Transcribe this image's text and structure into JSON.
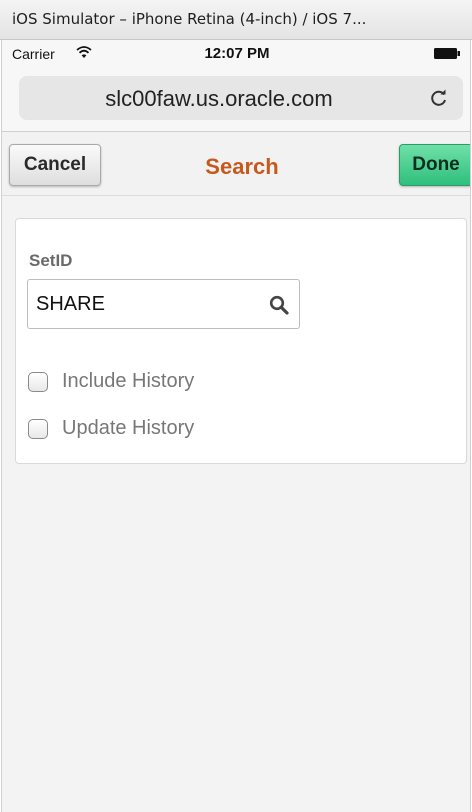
{
  "window": {
    "title": "iOS Simulator – iPhone Retina (4-inch) / iOS 7..."
  },
  "statusbar": {
    "carrier": "Carrier",
    "time": "12:07 PM"
  },
  "browser": {
    "url": "slc00faw.us.oracle.com"
  },
  "navbar": {
    "cancel_label": "Cancel",
    "title": "Search",
    "done_label": "Done"
  },
  "form": {
    "setid_label": "SetID",
    "setid_value": "SHARE",
    "options": [
      {
        "label": "Include History",
        "checked": false
      },
      {
        "label": "Update History",
        "checked": false
      }
    ]
  },
  "colors": {
    "accent_title": "#c65a1e",
    "done_button": "#2fbf7d"
  },
  "icons": [
    "wifi-icon",
    "battery-icon",
    "reload-icon",
    "search-icon",
    "checkbox"
  ]
}
